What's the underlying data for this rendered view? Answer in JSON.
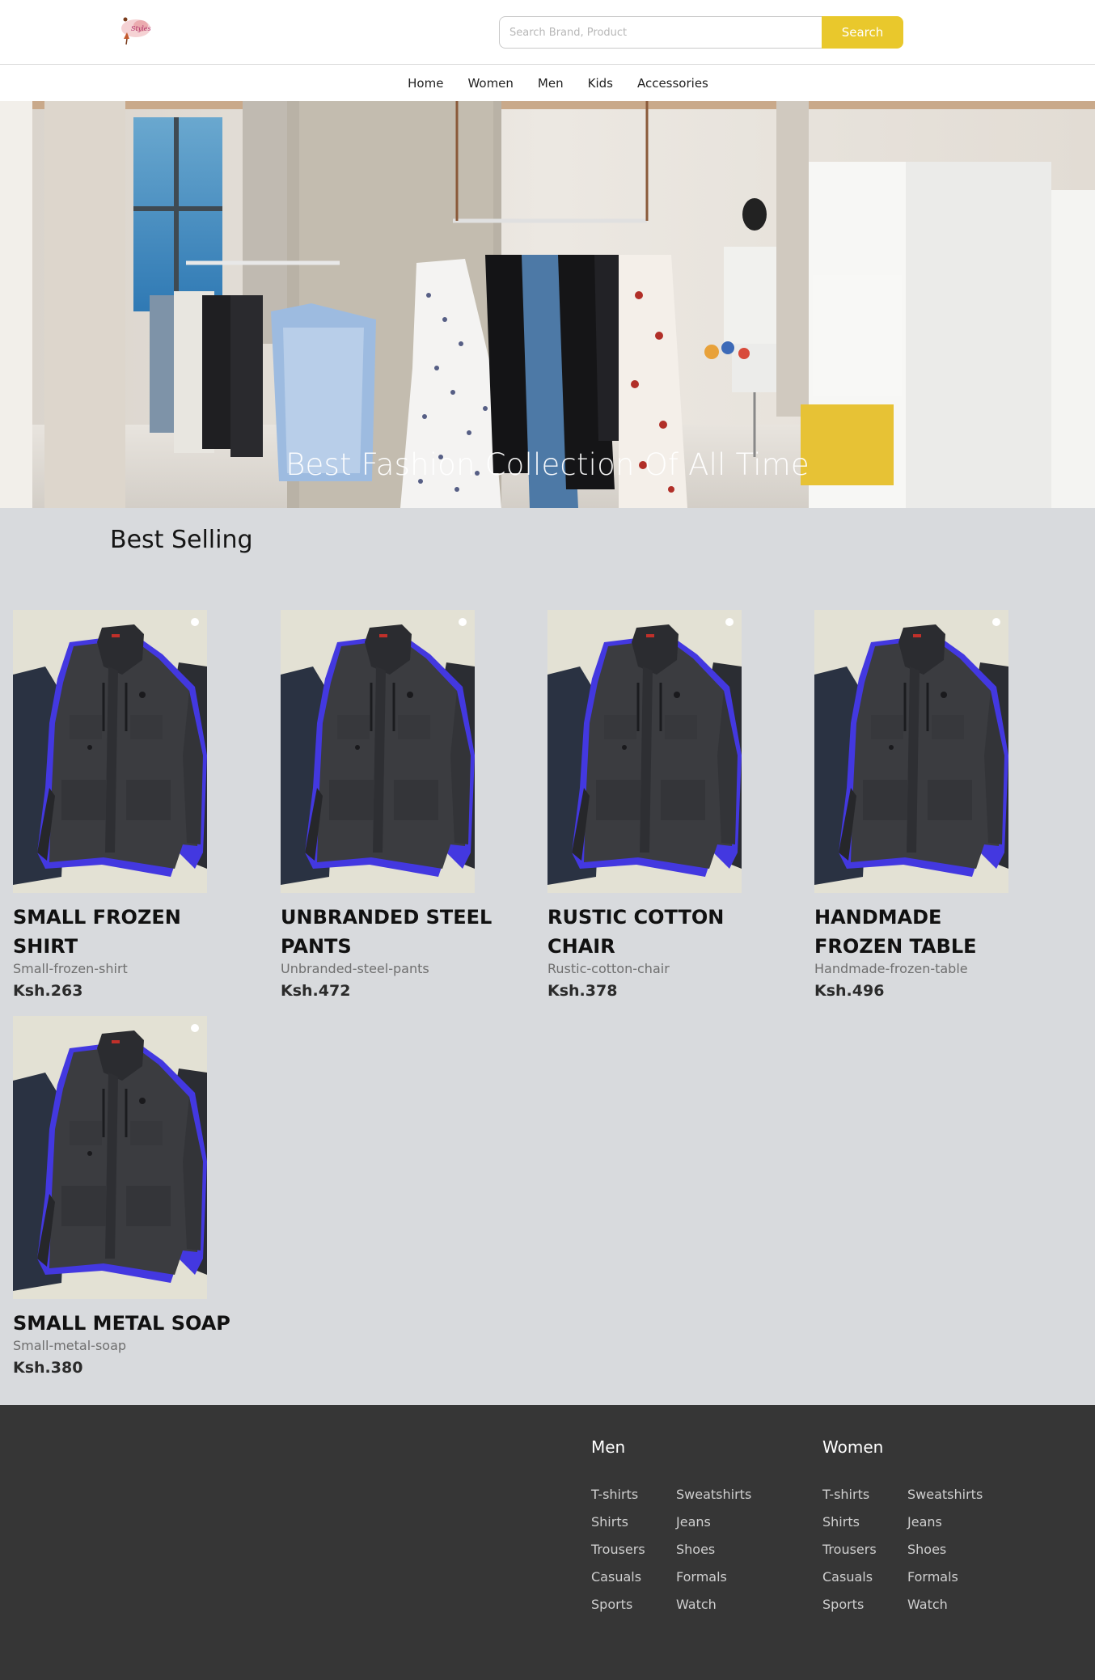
{
  "header": {
    "logo_icon": "boutique-logo-icon",
    "search_placeholder": "Search Brand, Product",
    "search_label": "Search",
    "accent": "#e9c82c"
  },
  "nav": [
    "Home",
    "Women",
    "Men",
    "Kids",
    "Accessories"
  ],
  "hero": {
    "title": "Best Fashion Collection Of All Time"
  },
  "best_selling": {
    "title": "Best Selling",
    "products": [
      {
        "name": "Small Frozen Shirt",
        "slug": "Small-frozen-shirt",
        "price": "Ksh.263",
        "image_icon": "jacket-image"
      },
      {
        "name": "Unbranded Steel Pants",
        "slug": "Unbranded-steel-pants",
        "price": "Ksh.472",
        "image_icon": "jacket-image"
      },
      {
        "name": "Rustic Cotton Chair",
        "slug": "Rustic-cotton-chair",
        "price": "Ksh.378",
        "image_icon": "jacket-image"
      },
      {
        "name": "Handmade Frozen Table",
        "slug": "Handmade-frozen-table",
        "price": "Ksh.496",
        "image_icon": "jacket-image"
      },
      {
        "name": "Small Metal Soap",
        "slug": "Small-metal-soap",
        "price": "Ksh.380",
        "image_icon": "jacket-image"
      }
    ]
  },
  "footer": {
    "background": "#363636",
    "columns": [
      {
        "title": "Men",
        "links": [
          "T-shirts",
          "Sweatshirts",
          "Shirts",
          "Jeans",
          "Trousers",
          "Shoes",
          "Casuals",
          "Formals",
          "Sports",
          "Watch"
        ]
      },
      {
        "title": "Women",
        "links": [
          "T-shirts",
          "Sweatshirts",
          "Shirts",
          "Jeans",
          "Trousers",
          "Shoes",
          "Casuals",
          "Formals",
          "Sports",
          "Watch"
        ]
      }
    ]
  }
}
